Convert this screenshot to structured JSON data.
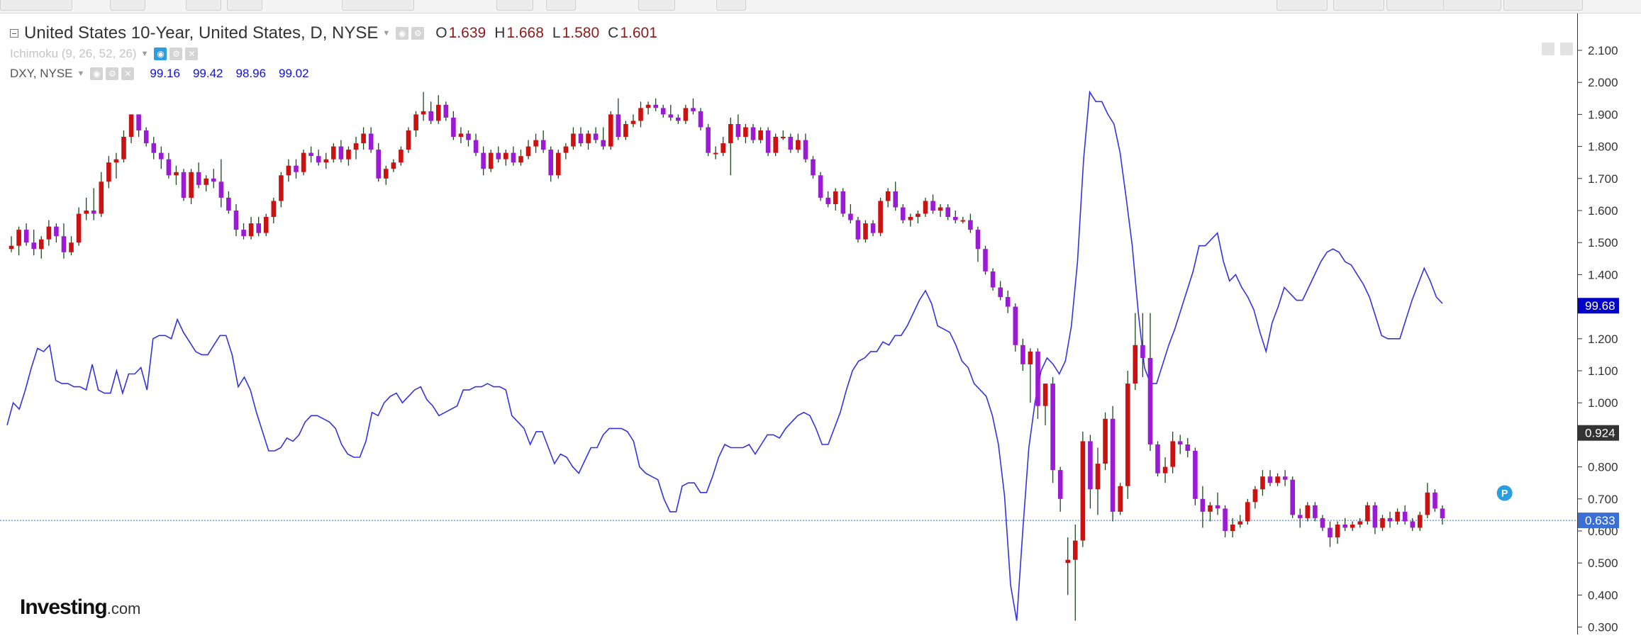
{
  "header": {
    "title": "United States 10-Year, United States, D, NYSE",
    "ohlc": [
      {
        "key": "O",
        "value": "1.639"
      },
      {
        "key": "H",
        "value": "1.668"
      },
      {
        "key": "L",
        "value": "1.580"
      },
      {
        "key": "C",
        "value": "1.601"
      }
    ]
  },
  "indicators": {
    "ichimoku_label": "Ichimoku (9, 26, 52, 26)",
    "dxy_label": "DXY, NYSE",
    "dxy_values": [
      "99.16",
      "99.42",
      "98.96",
      "99.02"
    ]
  },
  "logo": {
    "brand": "Investing",
    "suffix": ".com"
  },
  "colors": {
    "bull_candle": "#cc1111",
    "bear_candle": "#9b1ad6",
    "wick": "#1a4a1a",
    "dxy_line": "#3333dd",
    "last_price_line": "#3b6fd6",
    "dxy_badge": "#0000cc",
    "ichimoku_badge": "#333333",
    "price_badge": "#3b6fd6",
    "p_marker": "#2a9ee0"
  },
  "icons": [
    "minus-box-icon",
    "caret-down-icon",
    "eye-icon",
    "gear-icon",
    "close-icon",
    "arrow-down-icon",
    "expand-icon"
  ],
  "chart_data": {
    "type": "candlestick",
    "instrument": "United States 10-Year, United States, D, NYSE",
    "y_axis": {
      "side": "right",
      "ticks": [
        "2.100",
        "2.000",
        "1.900",
        "1.800",
        "1.700",
        "1.600",
        "1.500",
        "1.400",
        "1.300",
        "1.200",
        "1.100",
        "1.000",
        "0.900",
        "0.800",
        "0.700",
        "0.600",
        "0.500",
        "0.400",
        "0.300"
      ],
      "range": [
        0.22,
        2.15
      ]
    },
    "price_labels": {
      "dxy_last": "99.68",
      "ichimoku_last": "0.924",
      "yield_last": "0.633"
    },
    "marker_label": "P",
    "candles": [
      [
        1.48,
        1.52,
        1.47,
        1.49
      ],
      [
        1.49,
        1.55,
        1.46,
        1.54
      ],
      [
        1.54,
        1.56,
        1.49,
        1.5
      ],
      [
        1.5,
        1.54,
        1.46,
        1.48
      ],
      [
        1.48,
        1.52,
        1.45,
        1.51
      ],
      [
        1.51,
        1.57,
        1.49,
        1.55
      ],
      [
        1.55,
        1.56,
        1.5,
        1.52
      ],
      [
        1.52,
        1.56,
        1.45,
        1.47
      ],
      [
        1.47,
        1.52,
        1.46,
        1.5
      ],
      [
        1.5,
        1.61,
        1.49,
        1.59
      ],
      [
        1.59,
        1.64,
        1.57,
        1.6
      ],
      [
        1.6,
        1.67,
        1.57,
        1.59
      ],
      [
        1.59,
        1.72,
        1.58,
        1.69
      ],
      [
        1.69,
        1.77,
        1.67,
        1.75
      ],
      [
        1.75,
        1.78,
        1.7,
        1.76
      ],
      [
        1.76,
        1.85,
        1.75,
        1.83
      ],
      [
        1.83,
        1.9,
        1.81,
        1.9
      ],
      [
        1.9,
        1.9,
        1.83,
        1.85
      ],
      [
        1.85,
        1.86,
        1.8,
        1.81
      ],
      [
        1.81,
        1.83,
        1.76,
        1.78
      ],
      [
        1.78,
        1.8,
        1.73,
        1.76
      ],
      [
        1.76,
        1.78,
        1.7,
        1.71
      ],
      [
        1.71,
        1.74,
        1.68,
        1.72
      ],
      [
        1.72,
        1.73,
        1.63,
        1.64
      ],
      [
        1.64,
        1.73,
        1.62,
        1.72
      ],
      [
        1.72,
        1.75,
        1.67,
        1.68
      ],
      [
        1.68,
        1.71,
        1.66,
        1.7
      ],
      [
        1.7,
        1.73,
        1.67,
        1.69
      ],
      [
        1.69,
        1.76,
        1.61,
        1.64
      ],
      [
        1.64,
        1.66,
        1.59,
        1.6
      ],
      [
        1.6,
        1.62,
        1.52,
        1.54
      ],
      [
        1.54,
        1.56,
        1.51,
        1.52
      ],
      [
        1.52,
        1.58,
        1.51,
        1.56
      ],
      [
        1.56,
        1.58,
        1.52,
        1.53
      ],
      [
        1.53,
        1.59,
        1.52,
        1.58
      ],
      [
        1.58,
        1.64,
        1.56,
        1.63
      ],
      [
        1.63,
        1.72,
        1.61,
        1.71
      ],
      [
        1.71,
        1.76,
        1.69,
        1.74
      ],
      [
        1.74,
        1.76,
        1.7,
        1.72
      ],
      [
        1.72,
        1.79,
        1.71,
        1.78
      ],
      [
        1.78,
        1.8,
        1.75,
        1.77
      ],
      [
        1.77,
        1.79,
        1.74,
        1.75
      ],
      [
        1.75,
        1.78,
        1.73,
        1.76
      ],
      [
        1.76,
        1.81,
        1.75,
        1.8
      ],
      [
        1.8,
        1.82,
        1.75,
        1.76
      ],
      [
        1.76,
        1.8,
        1.74,
        1.79
      ],
      [
        1.79,
        1.83,
        1.76,
        1.81
      ],
      [
        1.81,
        1.86,
        1.79,
        1.84
      ],
      [
        1.84,
        1.86,
        1.78,
        1.79
      ],
      [
        1.79,
        1.81,
        1.69,
        1.7
      ],
      [
        1.7,
        1.74,
        1.68,
        1.73
      ],
      [
        1.73,
        1.76,
        1.72,
        1.75
      ],
      [
        1.75,
        1.8,
        1.74,
        1.79
      ],
      [
        1.79,
        1.86,
        1.78,
        1.85
      ],
      [
        1.85,
        1.91,
        1.83,
        1.9
      ],
      [
        1.9,
        1.97,
        1.88,
        1.91
      ],
      [
        1.91,
        1.94,
        1.87,
        1.88
      ],
      [
        1.88,
        1.96,
        1.87,
        1.93
      ],
      [
        1.93,
        1.94,
        1.88,
        1.89
      ],
      [
        1.89,
        1.91,
        1.82,
        1.83
      ],
      [
        1.83,
        1.86,
        1.81,
        1.84
      ],
      [
        1.84,
        1.85,
        1.8,
        1.82
      ],
      [
        1.82,
        1.84,
        1.77,
        1.78
      ],
      [
        1.78,
        1.8,
        1.71,
        1.73
      ],
      [
        1.73,
        1.79,
        1.72,
        1.78
      ],
      [
        1.78,
        1.8,
        1.75,
        1.76
      ],
      [
        1.76,
        1.79,
        1.74,
        1.78
      ],
      [
        1.78,
        1.8,
        1.74,
        1.75
      ],
      [
        1.75,
        1.79,
        1.74,
        1.77
      ],
      [
        1.77,
        1.82,
        1.76,
        1.8
      ],
      [
        1.8,
        1.84,
        1.78,
        1.82
      ],
      [
        1.82,
        1.85,
        1.78,
        1.79
      ],
      [
        1.79,
        1.8,
        1.69,
        1.71
      ],
      [
        1.71,
        1.79,
        1.7,
        1.78
      ],
      [
        1.78,
        1.81,
        1.76,
        1.8
      ],
      [
        1.8,
        1.86,
        1.79,
        1.84
      ],
      [
        1.84,
        1.86,
        1.8,
        1.81
      ],
      [
        1.81,
        1.85,
        1.79,
        1.84
      ],
      [
        1.84,
        1.86,
        1.81,
        1.82
      ],
      [
        1.82,
        1.86,
        1.79,
        1.8
      ],
      [
        1.8,
        1.91,
        1.79,
        1.9
      ],
      [
        1.9,
        1.95,
        1.82,
        1.83
      ],
      [
        1.83,
        1.88,
        1.82,
        1.87
      ],
      [
        1.87,
        1.9,
        1.86,
        1.88
      ],
      [
        1.88,
        1.94,
        1.86,
        1.92
      ],
      [
        1.92,
        1.94,
        1.9,
        1.93
      ],
      [
        1.93,
        1.95,
        1.91,
        1.92
      ],
      [
        1.92,
        1.93,
        1.89,
        1.9
      ],
      [
        1.9,
        1.93,
        1.88,
        1.89
      ],
      [
        1.89,
        1.9,
        1.87,
        1.88
      ],
      [
        1.88,
        1.93,
        1.87,
        1.92
      ],
      [
        1.92,
        1.95,
        1.9,
        1.91
      ],
      [
        1.91,
        1.92,
        1.85,
        1.86
      ],
      [
        1.86,
        1.87,
        1.77,
        1.78
      ],
      [
        1.78,
        1.8,
        1.76,
        1.78
      ],
      [
        1.78,
        1.83,
        1.77,
        1.81
      ],
      [
        1.81,
        1.89,
        1.71,
        1.87
      ],
      [
        1.87,
        1.9,
        1.82,
        1.83
      ],
      [
        1.83,
        1.87,
        1.81,
        1.86
      ],
      [
        1.86,
        1.87,
        1.81,
        1.82
      ],
      [
        1.82,
        1.86,
        1.81,
        1.85
      ],
      [
        1.85,
        1.86,
        1.77,
        1.78
      ],
      [
        1.78,
        1.84,
        1.77,
        1.83
      ],
      [
        1.83,
        1.85,
        1.82,
        1.83
      ],
      [
        1.83,
        1.84,
        1.78,
        1.79
      ],
      [
        1.79,
        1.84,
        1.78,
        1.82
      ],
      [
        1.82,
        1.84,
        1.75,
        1.76
      ],
      [
        1.76,
        1.77,
        1.7,
        1.71
      ],
      [
        1.71,
        1.72,
        1.63,
        1.64
      ],
      [
        1.64,
        1.66,
        1.61,
        1.62
      ],
      [
        1.62,
        1.67,
        1.6,
        1.66
      ],
      [
        1.66,
        1.67,
        1.58,
        1.59
      ],
      [
        1.59,
        1.62,
        1.56,
        1.57
      ],
      [
        1.57,
        1.58,
        1.5,
        1.51
      ],
      [
        1.51,
        1.57,
        1.5,
        1.56
      ],
      [
        1.56,
        1.57,
        1.52,
        1.53
      ],
      [
        1.53,
        1.64,
        1.52,
        1.63
      ],
      [
        1.63,
        1.67,
        1.61,
        1.66
      ],
      [
        1.66,
        1.69,
        1.6,
        1.61
      ],
      [
        1.61,
        1.62,
        1.56,
        1.57
      ],
      [
        1.57,
        1.59,
        1.55,
        1.58
      ],
      [
        1.58,
        1.6,
        1.56,
        1.59
      ],
      [
        1.59,
        1.64,
        1.58,
        1.63
      ],
      [
        1.63,
        1.65,
        1.59,
        1.6
      ],
      [
        1.6,
        1.62,
        1.58,
        1.61
      ],
      [
        1.61,
        1.62,
        1.57,
        1.58
      ],
      [
        1.58,
        1.6,
        1.56,
        1.57
      ],
      [
        1.57,
        1.58,
        1.56,
        1.57
      ],
      [
        1.57,
        1.59,
        1.53,
        1.54
      ],
      [
        1.54,
        1.55,
        1.44,
        1.48
      ],
      [
        1.48,
        1.49,
        1.4,
        1.41
      ],
      [
        1.41,
        1.42,
        1.35,
        1.36
      ],
      [
        1.36,
        1.38,
        1.32,
        1.33
      ],
      [
        1.33,
        1.35,
        1.28,
        1.3
      ],
      [
        1.3,
        1.31,
        1.16,
        1.18
      ],
      [
        1.18,
        1.2,
        1.1,
        1.12
      ],
      [
        1.12,
        1.17,
        1.0,
        1.16
      ],
      [
        1.16,
        1.17,
        0.95,
        0.99
      ],
      [
        0.99,
        1.02,
        0.93,
        1.06
      ],
      [
        1.06,
        1.08,
        0.75,
        0.79
      ],
      [
        0.79,
        0.8,
        0.66,
        0.7
      ],
      [
        0.5,
        0.58,
        0.4,
        0.51
      ],
      [
        0.51,
        0.62,
        0.32,
        0.57
      ],
      [
        0.57,
        0.91,
        0.55,
        0.88
      ],
      [
        0.88,
        0.9,
        0.67,
        0.73
      ],
      [
        0.73,
        0.86,
        0.65,
        0.81
      ],
      [
        0.81,
        0.97,
        0.79,
        0.95
      ],
      [
        0.95,
        0.99,
        0.63,
        0.66
      ],
      [
        0.66,
        0.75,
        0.65,
        0.74
      ],
      [
        0.74,
        1.1,
        0.7,
        1.06
      ],
      [
        1.06,
        1.28,
        1.04,
        1.18
      ],
      [
        1.18,
        1.28,
        1.08,
        1.14
      ],
      [
        1.14,
        1.28,
        0.85,
        0.87
      ],
      [
        0.87,
        0.88,
        0.77,
        0.78
      ],
      [
        0.78,
        0.83,
        0.75,
        0.8
      ],
      [
        0.8,
        0.91,
        0.78,
        0.88
      ],
      [
        0.88,
        0.9,
        0.84,
        0.87
      ],
      [
        0.87,
        0.89,
        0.83,
        0.85
      ],
      [
        0.85,
        0.86,
        0.68,
        0.7
      ],
      [
        0.7,
        0.74,
        0.61,
        0.66
      ],
      [
        0.66,
        0.69,
        0.63,
        0.68
      ],
      [
        0.68,
        0.72,
        0.65,
        0.67
      ],
      [
        0.67,
        0.68,
        0.58,
        0.6
      ],
      [
        0.6,
        0.64,
        0.58,
        0.62
      ],
      [
        0.62,
        0.65,
        0.61,
        0.63
      ],
      [
        0.63,
        0.7,
        0.62,
        0.69
      ],
      [
        0.69,
        0.74,
        0.67,
        0.73
      ],
      [
        0.73,
        0.79,
        0.71,
        0.77
      ],
      [
        0.77,
        0.79,
        0.74,
        0.75
      ],
      [
        0.75,
        0.78,
        0.74,
        0.77
      ],
      [
        0.77,
        0.79,
        0.74,
        0.76
      ],
      [
        0.76,
        0.77,
        0.64,
        0.65
      ],
      [
        0.65,
        0.67,
        0.61,
        0.64
      ],
      [
        0.64,
        0.69,
        0.63,
        0.68
      ],
      [
        0.68,
        0.69,
        0.63,
        0.64
      ],
      [
        0.64,
        0.65,
        0.6,
        0.61
      ],
      [
        0.61,
        0.63,
        0.55,
        0.58
      ],
      [
        0.58,
        0.63,
        0.56,
        0.62
      ],
      [
        0.62,
        0.64,
        0.6,
        0.61
      ],
      [
        0.61,
        0.63,
        0.6,
        0.62
      ],
      [
        0.62,
        0.64,
        0.61,
        0.63
      ],
      [
        0.63,
        0.69,
        0.62,
        0.68
      ],
      [
        0.68,
        0.69,
        0.59,
        0.61
      ],
      [
        0.61,
        0.65,
        0.6,
        0.64
      ],
      [
        0.64,
        0.66,
        0.61,
        0.63
      ],
      [
        0.63,
        0.67,
        0.62,
        0.66
      ],
      [
        0.66,
        0.68,
        0.62,
        0.63
      ],
      [
        0.63,
        0.64,
        0.6,
        0.61
      ],
      [
        0.61,
        0.66,
        0.6,
        0.65
      ],
      [
        0.65,
        0.75,
        0.64,
        0.72
      ],
      [
        0.72,
        0.73,
        0.66,
        0.67
      ],
      [
        0.67,
        0.68,
        0.62,
        0.64
      ]
    ],
    "dxy_overlay": {
      "name": "DXY, NYSE",
      "last": 99.68,
      "values_on_yield_scale": [
        0.93,
        1.0,
        0.98,
        1.04,
        1.11,
        1.17,
        1.16,
        1.18,
        1.07,
        1.06,
        1.06,
        1.05,
        1.05,
        1.04,
        1.12,
        1.04,
        1.03,
        1.03,
        1.1,
        1.03,
        1.09,
        1.09,
        1.11,
        1.04,
        1.2,
        1.21,
        1.21,
        1.2,
        1.26,
        1.22,
        1.19,
        1.16,
        1.15,
        1.15,
        1.18,
        1.21,
        1.21,
        1.15,
        1.05,
        1.08,
        1.04,
        0.97,
        0.91,
        0.85,
        0.85,
        0.86,
        0.89,
        0.88,
        0.9,
        0.94,
        0.96,
        0.96,
        0.95,
        0.94,
        0.92,
        0.87,
        0.84,
        0.83,
        0.83,
        0.88,
        0.97,
        0.96,
        1.0,
        1.02,
        1.03,
        1.0,
        1.02,
        1.04,
        1.05,
        1.01,
        0.99,
        0.96,
        0.97,
        0.98,
        0.99,
        1.04,
        1.04,
        1.05,
        1.05,
        1.06,
        1.05,
        1.05,
        1.04,
        0.96,
        0.94,
        0.92,
        0.87,
        0.91,
        0.91,
        0.86,
        0.81,
        0.84,
        0.83,
        0.8,
        0.78,
        0.82,
        0.86,
        0.86,
        0.9,
        0.92,
        0.92,
        0.92,
        0.91,
        0.88,
        0.8,
        0.78,
        0.77,
        0.76,
        0.7,
        0.66,
        0.66,
        0.74,
        0.75,
        0.75,
        0.72,
        0.72,
        0.77,
        0.83,
        0.87,
        0.86,
        0.86,
        0.86,
        0.87,
        0.84,
        0.87,
        0.9,
        0.9,
        0.89,
        0.92,
        0.94,
        0.96,
        0.97,
        0.96,
        0.92,
        0.87,
        0.87,
        0.92,
        0.97,
        1.04,
        1.1,
        1.13,
        1.14,
        1.16,
        1.16,
        1.19,
        1.18,
        1.21,
        1.21,
        1.24,
        1.28,
        1.32,
        1.35,
        1.31,
        1.24,
        1.23,
        1.22,
        1.18,
        1.13,
        1.11,
        1.06,
        1.04,
        1.02,
        0.96,
        0.87,
        0.71,
        0.43,
        0.32,
        0.6,
        0.86,
        1.0,
        1.1,
        1.14,
        1.12,
        1.09,
        1.13,
        1.24,
        1.44,
        1.76,
        1.97,
        1.94,
        1.94,
        1.9,
        1.87,
        1.78,
        1.64,
        1.49,
        1.28,
        1.11,
        1.06,
        1.06,
        1.12,
        1.18,
        1.23,
        1.29,
        1.35,
        1.41,
        1.49,
        1.49,
        1.51,
        1.53,
        1.44,
        1.38,
        1.4,
        1.36,
        1.33,
        1.29,
        1.22,
        1.16,
        1.25,
        1.3,
        1.36,
        1.34,
        1.32,
        1.32,
        1.36,
        1.4,
        1.44,
        1.47,
        1.48,
        1.47,
        1.44,
        1.43,
        1.4,
        1.37,
        1.33,
        1.27,
        1.21,
        1.2,
        1.2,
        1.2,
        1.26,
        1.32,
        1.37,
        1.42,
        1.38,
        1.33,
        1.31
      ]
    }
  }
}
